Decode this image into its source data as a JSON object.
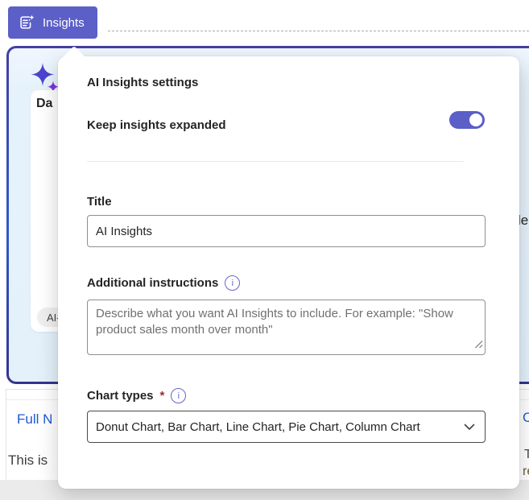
{
  "toolbar": {
    "insights_label": "Insights"
  },
  "popover": {
    "heading": "AI Insights settings",
    "keep_expanded_label": "Keep insights expanded",
    "keep_expanded_on": true,
    "title_field": {
      "label": "Title",
      "value": "AI Insights"
    },
    "instructions_field": {
      "label": "Additional instructions",
      "placeholder": "Describe what you want AI Insights to include. For example: \"Show product sales month over month\""
    },
    "chart_types_field": {
      "label": "Chart types",
      "required": "*",
      "value": "Donut Chart, Bar Chart, Line Chart, Pie Chart, Column Chart"
    }
  },
  "icons": {
    "info_glyph": "i"
  },
  "background_fragments": {
    "card_title": "Da",
    "badge": "AI-",
    "card_right_text": "le",
    "table_header_left": "Full N",
    "table_header_right": "C",
    "row_left": "This is",
    "row_right_1": "T",
    "row_right_2": "re"
  },
  "colors": {
    "brand": "#5b5fc7",
    "card_border_top": "#43409f",
    "card_border_accent": "#2d59cc",
    "card_bg": "#e6f2fb",
    "sparkle_large": "#4b44ce",
    "sparkle_small": "#7d35dd",
    "link_blue": "#2057d4",
    "asterisk_red": "#a4262c"
  }
}
